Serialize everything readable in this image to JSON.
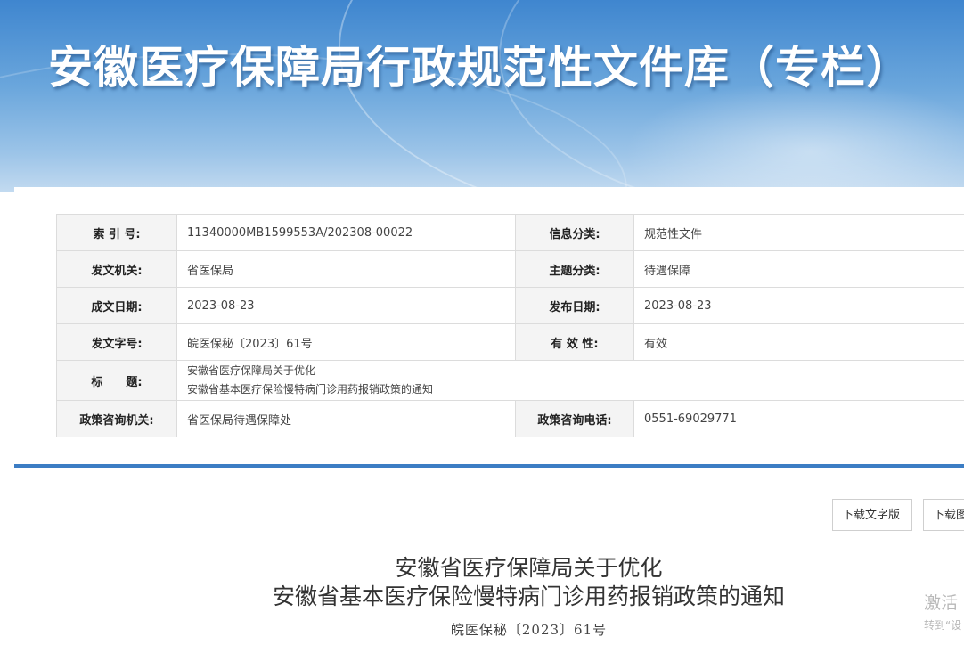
{
  "banner": {
    "title": "安徽医疗保障局行政规范性文件库（专栏）"
  },
  "info": {
    "index_label": "索 引 号:",
    "index_value": "11340000MB1599553A/202308-00022",
    "category_label": "信息分类:",
    "category_value": "规范性文件",
    "issuer_label": "发文机关:",
    "issuer_value": "省医保局",
    "topic_label": "主题分类:",
    "topic_value": "待遇保障",
    "created_label": "成文日期:",
    "created_value": "2023-08-23",
    "published_label": "发布日期:",
    "published_value": "2023-08-23",
    "docno_label": "发文字号:",
    "docno_value": "皖医保秘〔2023〕61号",
    "validity_label": "有 效 性:",
    "validity_value": "有效",
    "title_label": "标　　题:",
    "title_line1": "安徽省医疗保障局关于优化",
    "title_line2": "安徽省基本医疗保险慢特病门诊用药报销政策的通知",
    "consult_org_label": "政策咨询机关:",
    "consult_org_value": "省医保局待遇保障处",
    "consult_phone_label": "政策咨询电话:",
    "consult_phone_value": "0551-69029771"
  },
  "actions": {
    "download_text": "下载文字版",
    "download_image": "下载图片版"
  },
  "document": {
    "title_line1": "安徽省医疗保障局关于优化",
    "title_line2": "安徽省基本医疗保险慢特病门诊用药报销政策的通知",
    "number": "皖医保秘〔2023〕61号"
  },
  "watermark": {
    "line1": "激活",
    "line2": "转到“设"
  },
  "colors": {
    "banner_top": "#3f86cf",
    "divider": "#3c7dc4",
    "label_bg": "#f4f4f4",
    "border": "#dcdcdc"
  }
}
